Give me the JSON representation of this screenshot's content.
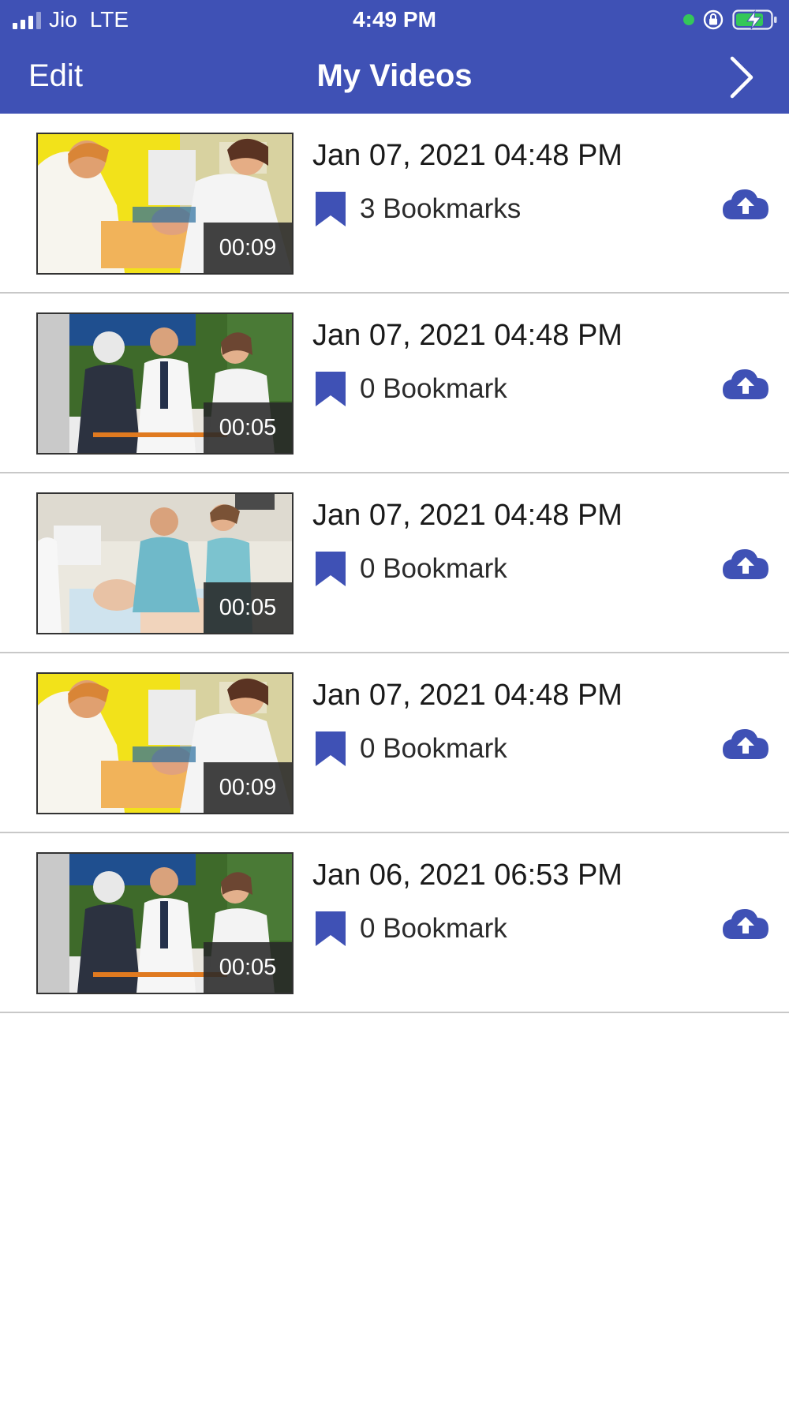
{
  "status_bar": {
    "carrier": "Jio",
    "network": "LTE",
    "time": "4:49 PM"
  },
  "nav": {
    "edit_label": "Edit",
    "title": "My Videos",
    "next_icon": "chevron-right-icon"
  },
  "colors": {
    "accent": "#3f51b5",
    "divider": "#c8c8c8",
    "text": "#1a1a1a"
  },
  "videos": [
    {
      "date": "Jan 07, 2021 04:48 PM",
      "bookmarks": "3 Bookmarks",
      "duration": "00:09",
      "thumbnail": "nurses-yellow-room"
    },
    {
      "date": "Jan 07, 2021 04:48 PM",
      "bookmarks": "0 Bookmark",
      "duration": "00:05",
      "thumbnail": "ambulance-stretcher"
    },
    {
      "date": "Jan 07, 2021 04:48 PM",
      "bookmarks": "0 Bookmark",
      "duration": "00:05",
      "thumbnail": "clinic-manikin"
    },
    {
      "date": "Jan 07, 2021 04:48 PM",
      "bookmarks": "0 Bookmark",
      "duration": "00:09",
      "thumbnail": "nurses-yellow-room"
    },
    {
      "date": "Jan 06, 2021 06:53 PM",
      "bookmarks": "0 Bookmark",
      "duration": "00:05",
      "thumbnail": "ambulance-stretcher"
    }
  ]
}
